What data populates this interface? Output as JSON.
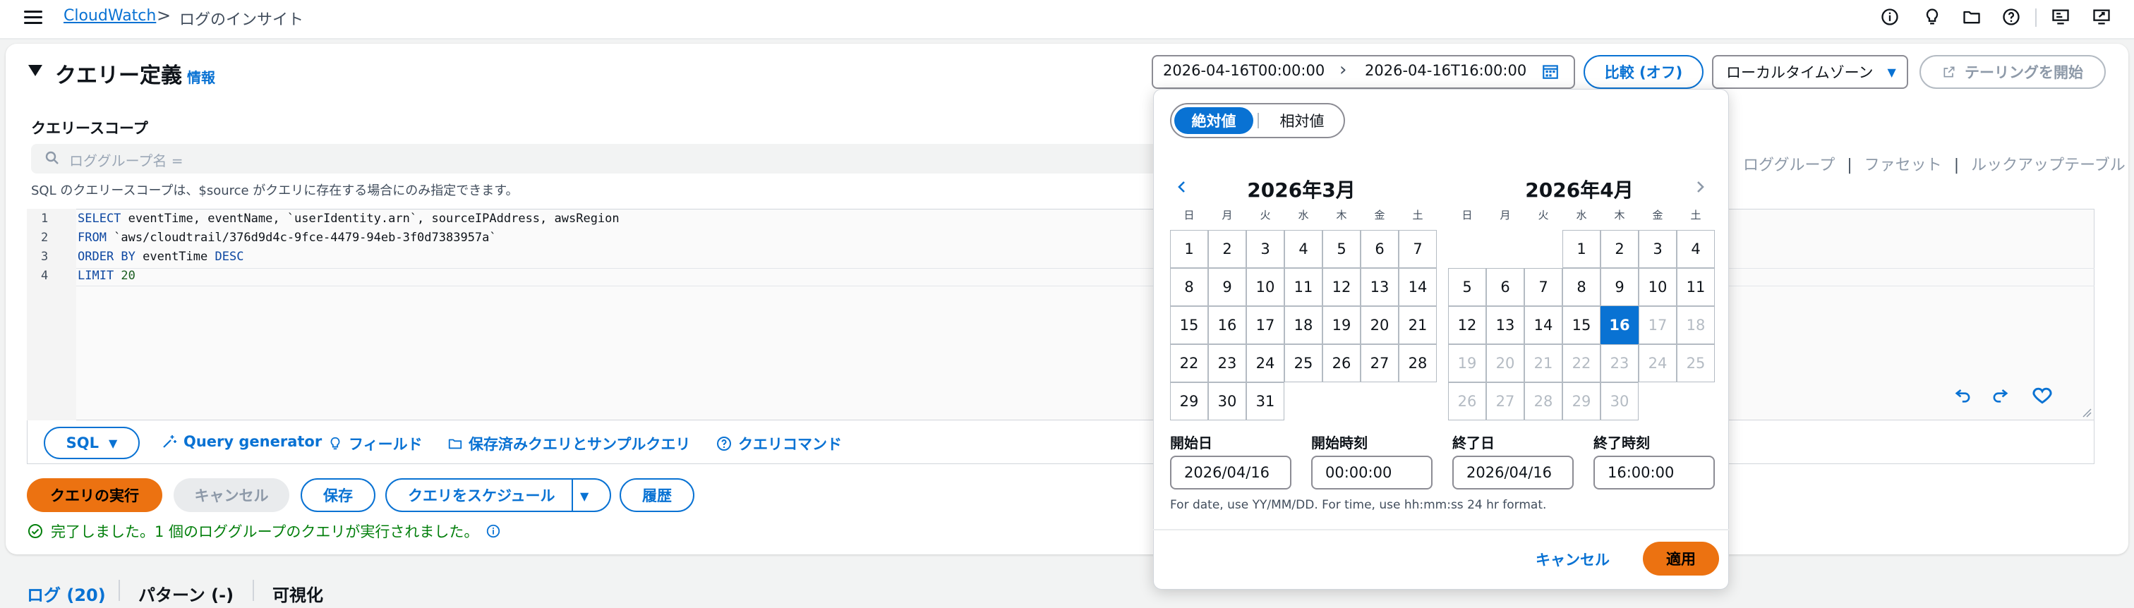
{
  "topbar": {
    "breadcrumb_root": "CloudWatch",
    "breadcrumb_separator": ">",
    "breadcrumb_current": "ログのインサイト",
    "icons": [
      "info-circle-icon",
      "lightbulb-icon",
      "folder-icon",
      "help-icon",
      "monitor-icon",
      "screen-share-icon"
    ]
  },
  "panel": {
    "title": "クエリー定義",
    "info_link": "情報"
  },
  "scope": {
    "label": "クエリースコープ",
    "placeholder": "ロググループ名 =",
    "hint": "SQL のクエリースコープは、$source がクエリに存在する場合にのみ指定できます。",
    "links": [
      "ロググループ",
      "ファセット",
      "ルックアップテーブル"
    ],
    "link_separator": "|"
  },
  "editor": {
    "lines": [
      {
        "n": "1",
        "kw": "SELECT",
        "rest": " eventTime, eventName, `userIdentity.arn`, sourceIPAddress, awsRegion"
      },
      {
        "n": "2",
        "kw": "FROM",
        "rest": " `aws/cloudtrail/376d9d4c-9fce-4479-94eb-3f0d7383957a`"
      },
      {
        "n": "3",
        "kw": "ORDER BY",
        "rest": " eventTime ",
        "kw2": "DESC"
      },
      {
        "n": "4",
        "kw": "LIMIT",
        "num": " 20"
      }
    ]
  },
  "toolbar": {
    "sql": "SQL",
    "query_generator": "Query generator",
    "fields": "フィールド",
    "saved_queries": "保存済みクエリとサンプルクエリ",
    "query_commands": "クエリコマンド"
  },
  "actions": {
    "run": "クエリの実行",
    "cancel": "キャンセル",
    "save": "保存",
    "schedule": "クエリをスケジュール",
    "history": "履歴"
  },
  "status": {
    "text": "完了しました。1 個のロググループのクエリが実行されました。"
  },
  "tabs": [
    {
      "label": "ログ (20)"
    },
    {
      "label": "パターン (-)"
    },
    {
      "label": "可視化"
    }
  ],
  "range": {
    "start": "2026-04-16T00:00:00",
    "end": "2026-04-16T16:00:00",
    "compare": "比較 (オフ)",
    "timezone": "ローカルタイムゾーン",
    "tail": "テーリングを開始"
  },
  "picker": {
    "mode_absolute": "絶対値",
    "mode_relative": "相対値",
    "weekdays": [
      "日",
      "月",
      "火",
      "水",
      "木",
      "金",
      "土"
    ],
    "months": [
      {
        "title": "2026年3月",
        "offset": 0,
        "days": 31,
        "disabled_from": 32,
        "selected": 0
      },
      {
        "title": "2026年4月",
        "offset": 3,
        "days": 30,
        "disabled_from": 17,
        "selected": 16
      }
    ],
    "start_date_label": "開始日",
    "start_time_label": "開始時刻",
    "end_date_label": "終了日",
    "end_time_label": "終了時刻",
    "start_date": "2026/04/16",
    "start_time": "00:00:00",
    "end_date": "2026/04/16",
    "end_time": "16:00:00",
    "hint": "For date, use YY/MM/DD. For time, use hh:mm:ss 24 hr format.",
    "cancel": "キャンセル",
    "apply": "適用"
  },
  "colors": {
    "accent": "#0972d3",
    "primary_button": "#ec7211",
    "success": "#037f0c"
  }
}
